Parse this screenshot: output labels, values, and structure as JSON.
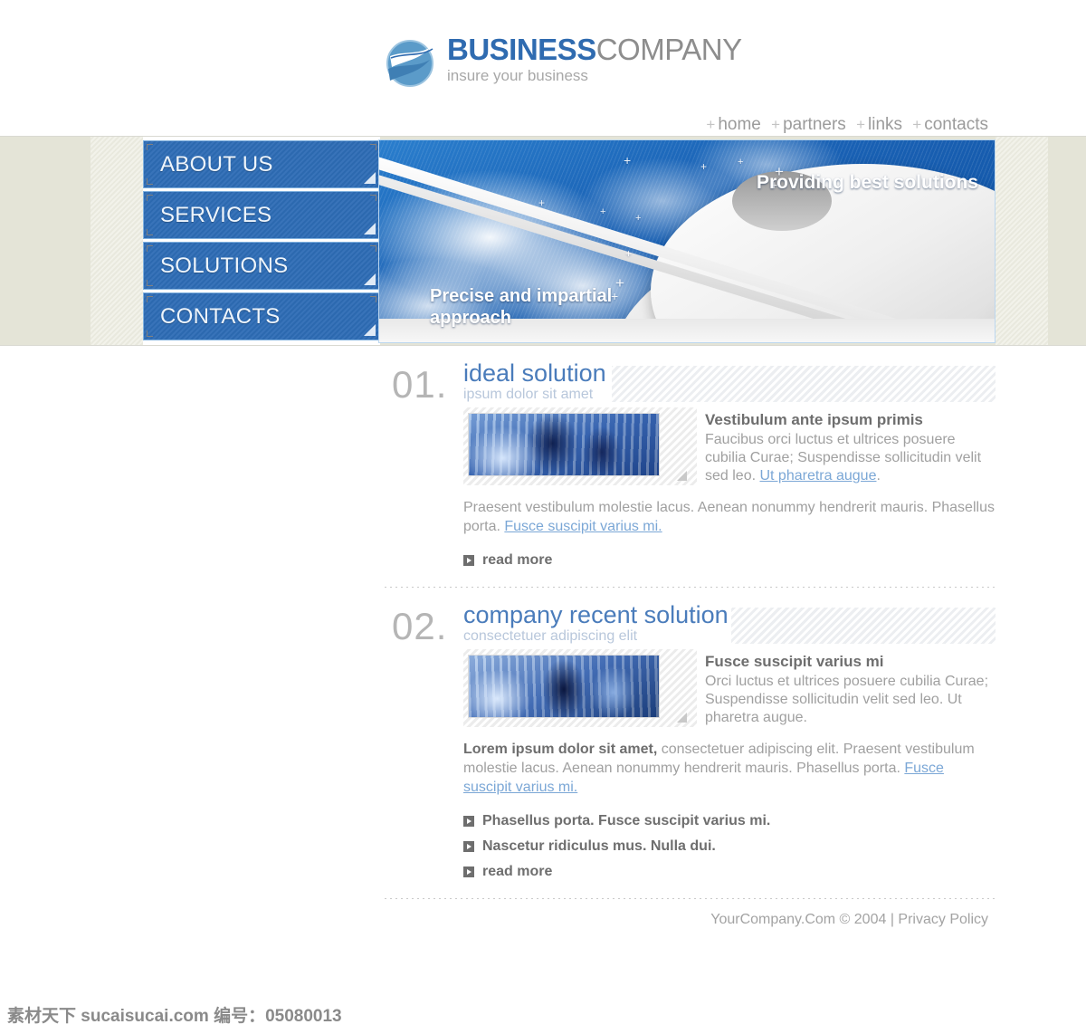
{
  "header": {
    "logo_icon": "globe-swoosh-icon",
    "brand_bold": "BUSINESS",
    "brand_light": "COMPANY",
    "tagline": "insure your business",
    "topnav": [
      {
        "label": "home"
      },
      {
        "label": "partners"
      },
      {
        "label": "links"
      },
      {
        "label": "contacts"
      }
    ],
    "nav_separator": "+"
  },
  "menu": {
    "items": [
      {
        "label": "ABOUT US"
      },
      {
        "label": "SERVICES"
      },
      {
        "label": "SOLUTIONS"
      },
      {
        "label": "CONTACTS"
      }
    ]
  },
  "banner": {
    "headline_right": "Providing best solutions",
    "headline_left_line1": "Precise and impartial",
    "headline_left_line2": "approach"
  },
  "sections": [
    {
      "number": "01.",
      "title": "ideal solution",
      "subtitle": "ipsum dolor sit amet",
      "thumb_alt": "office-people-photo",
      "lead_heading": "Vestibulum ante ipsum primis",
      "lead_text": "Faucibus orci luctus et ultrices posuere cubilia Curae; Suspendisse sollicitudin velit sed leo. ",
      "lead_link": "Ut pharetra augue",
      "lead_tail": ".",
      "body_text": "Praesent vestibulum molestie lacus. Aenean nonummy hendrerit mauris. Phasellus porta. ",
      "body_link": "Fusce suscipit varius mi. ",
      "bullets": [
        {
          "label": "read more"
        }
      ]
    },
    {
      "number": "02.",
      "title": "company recent solution",
      "subtitle": "consectetuer adipiscing elit",
      "thumb_alt": "business-meeting-photo",
      "lead_heading": "Fusce suscipit varius mi",
      "lead_text": "Orci luctus et ultrices posuere cubilia Curae; Suspendisse sollicitudin velit sed leo. Ut pharetra augue.",
      "lead_link": "",
      "lead_tail": "",
      "body_bold": "Lorem ipsum dolor sit amet,",
      "body_text": " consectetuer adipiscing elit. Praesent vestibulum molestie lacus. Aenean nonummy hendrerit mauris. Phasellus porta. ",
      "body_link": "Fusce suscipit varius mi. ",
      "bullets": [
        {
          "label": "Phasellus porta. Fusce suscipit varius mi."
        },
        {
          "label": "Nascetur ridiculus mus. Nulla dui."
        },
        {
          "label": "read more"
        }
      ]
    }
  ],
  "footer": {
    "text": "YourCompany.Com © 2004 | Privacy Policy"
  },
  "watermark": {
    "text": "素材天下 sucaisucai.com  编号：05080013"
  },
  "colors": {
    "brand_blue": "#2f6bb0",
    "menu_blue": "#2d6cb5",
    "band_beige": "#e4e4d7",
    "heading_blue": "#4a7cbb",
    "link_blue": "#7ba7d6",
    "body_gray": "#a0a0a0"
  }
}
